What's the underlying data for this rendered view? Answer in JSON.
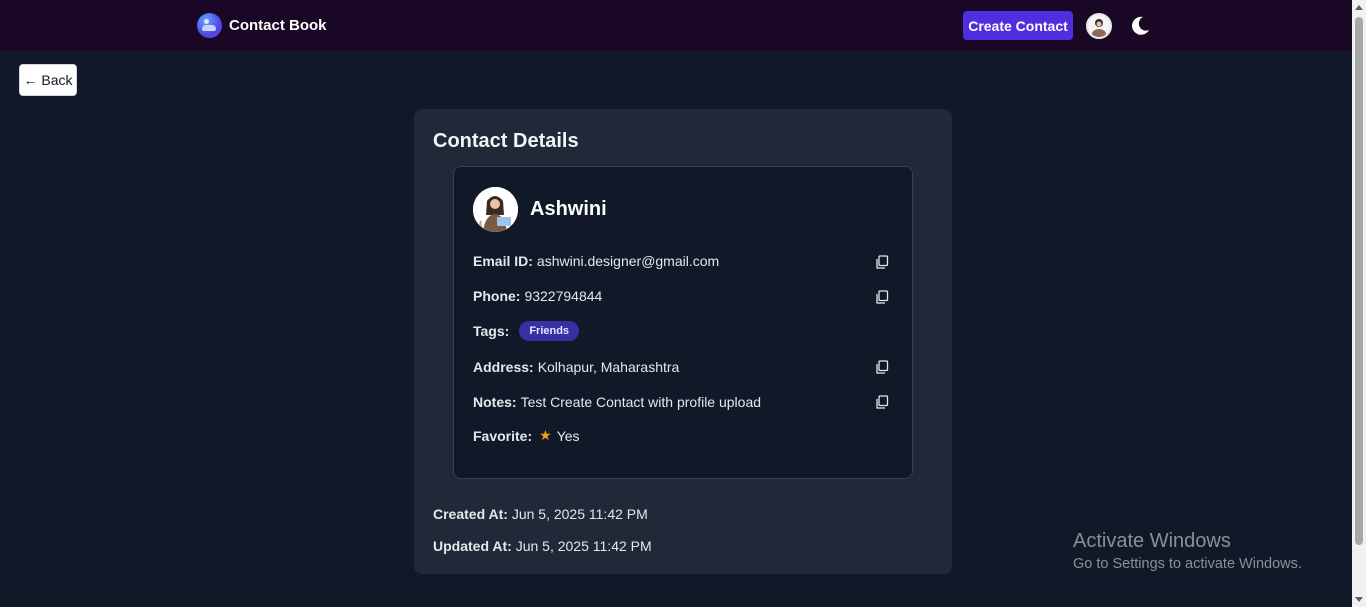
{
  "navbar": {
    "brand_title": "Contact Book",
    "create_label": "Create Contact",
    "logo_icon": "contact-book-logo-icon",
    "avatar_icon": "user-avatar-icon",
    "theme_icon": "moon-icon"
  },
  "back_label": "← Back",
  "card": {
    "title": "Contact Details",
    "name": "Ashwini",
    "fields": {
      "email_label": "Email ID:",
      "email_value": "ashwini.designer@gmail.com",
      "phone_label": "Phone:",
      "phone_value": "9322794844",
      "tags_label": "Tags:",
      "tags": [
        "Friends"
      ],
      "address_label": "Address:",
      "address_value": "Kolhapur, Maharashtra",
      "notes_label": "Notes:",
      "notes_value": "Test Create Contact with profile upload",
      "favorite_label": "Favorite:",
      "favorite_value": "Yes"
    },
    "created_label": "Created At:",
    "created_value": "Jun 5, 2025 11:42 PM",
    "updated_label": "Updated At:",
    "updated_value": "Jun 5, 2025 11:42 PM"
  },
  "watermark": {
    "line1": "Activate Windows",
    "line2": "Go to Settings to activate Windows."
  },
  "colors": {
    "navbar_bg": "#1a0726",
    "page_bg": "#111827",
    "card_bg": "#1f2937",
    "accent": "#4f2ee0",
    "tag_bg": "#3730a3",
    "star": "#f59e0b"
  }
}
